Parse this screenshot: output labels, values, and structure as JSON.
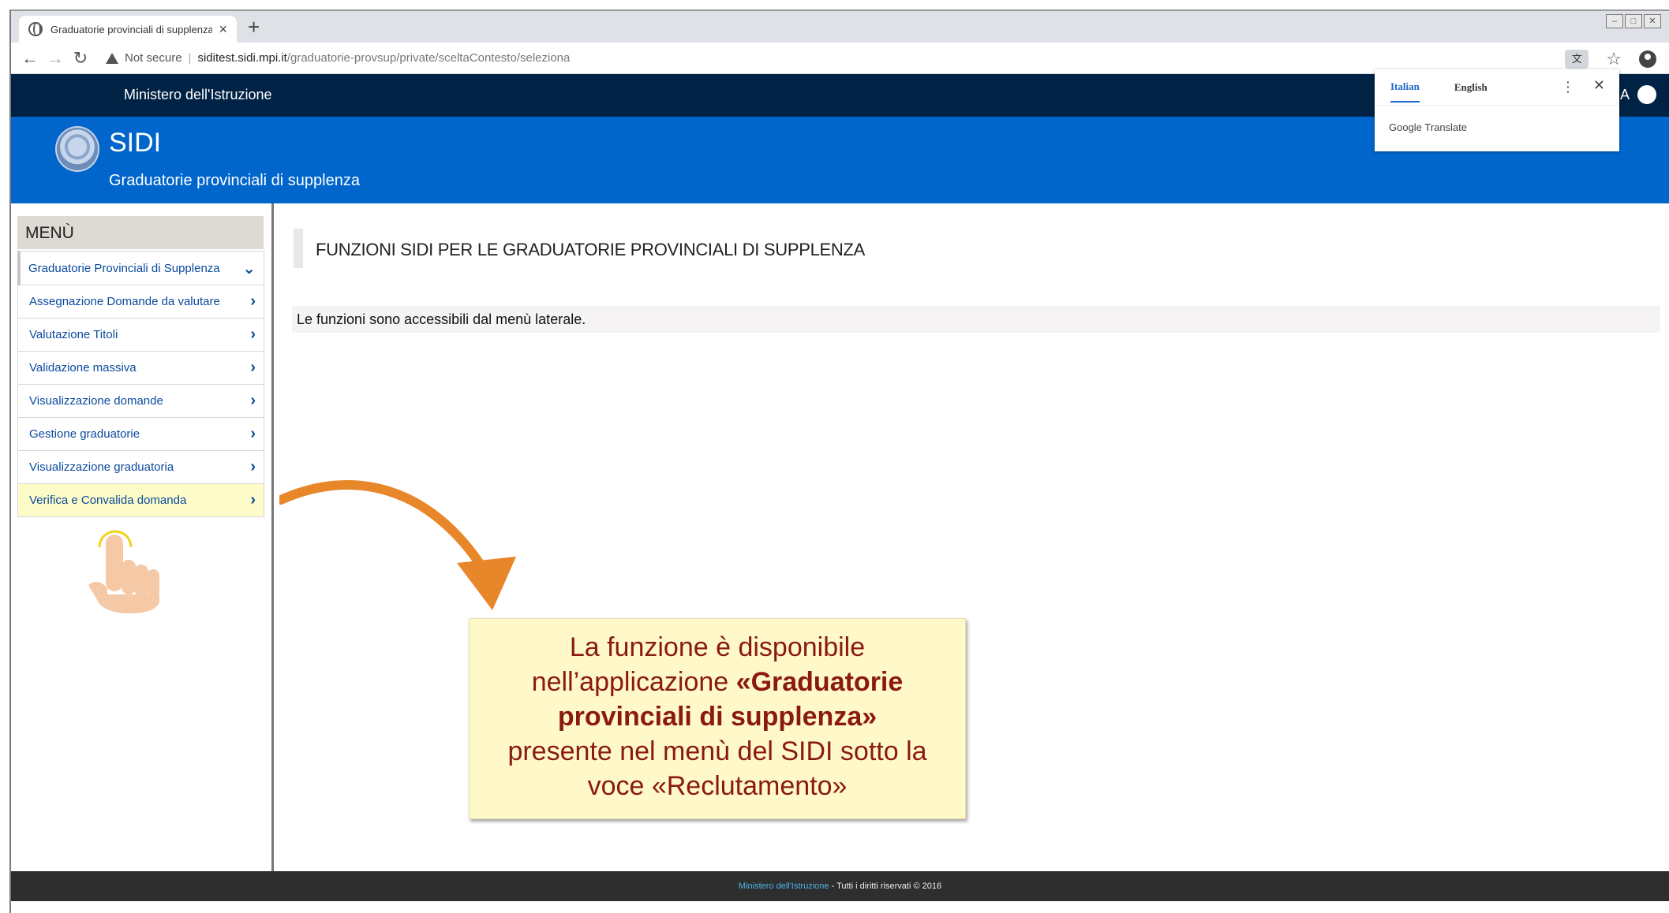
{
  "browser": {
    "tab_title": "Graduatorie provinciali di supplenza",
    "tab_close": "×",
    "new_tab": "+",
    "url_warning": "Not secure",
    "url_host": "siditest.sidi.mpi.it",
    "url_path": "/graduatorie-provsup/private/sceltaContesto/seleziona",
    "window_controls": [
      "–",
      "□",
      "✕"
    ]
  },
  "site": {
    "ministry": "Ministero dell'Istruzione",
    "name": "SIDI",
    "subtitle": "Graduatorie provinciali di supplenza"
  },
  "translate_popup": {
    "lang_active": "Italian",
    "lang_other": "English",
    "brand": "Google Translate"
  },
  "sidebar": {
    "title": "MENÙ",
    "section": "Graduatorie Provinciali di Supplenza",
    "items": [
      {
        "label": "Assegnazione Domande da valutare"
      },
      {
        "label": "Valutazione Titoli"
      },
      {
        "label": "Validazione massiva"
      },
      {
        "label": "Visualizzazione domande"
      },
      {
        "label": "Gestione graduatorie"
      },
      {
        "label": "Visualizzazione graduatoria"
      },
      {
        "label": "Verifica e Convalida domanda"
      }
    ]
  },
  "main": {
    "title": "FUNZIONI SIDI PER LE GRADUATORIE PROVINCIALI DI SUPPLENZA",
    "info": "Le funzioni sono accessibili dal menù laterale."
  },
  "callout": {
    "line1": "La funzione è disponibile",
    "line2_pre": "nell’applicazione ",
    "line2_bold": "«Graduatorie",
    "line3_bold": "provinciali di supplenza»",
    "line4": "presente nel menù del SIDI sotto la",
    "line5": "voce «Reclutamento»"
  },
  "footer": {
    "link": "Ministero dell'Istruzione",
    "text": " - Tutti i diritti riservati © 2016"
  },
  "colors": {
    "header_dark": "#002244",
    "header_blue": "#0066cc",
    "link_blue": "#0a4a9c",
    "highlight": "#fdfcc9",
    "callout_bg": "#fff8c8",
    "callout_text": "#8a1a10",
    "arrow": "#e8862a"
  }
}
